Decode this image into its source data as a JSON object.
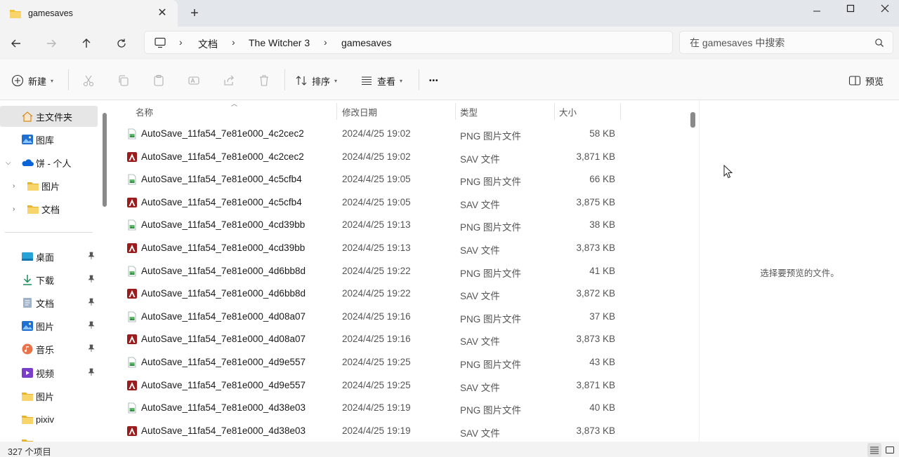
{
  "window": {
    "tab_title": "gamesaves",
    "tab_icon": "folder-icon",
    "new_tab_label": "+",
    "close_tab_label": "✕"
  },
  "address": {
    "crumbs": [
      "文档",
      "The Witcher 3",
      "gamesaves"
    ],
    "separator": "›"
  },
  "search": {
    "placeholder": "在 gamesaves 中搜索"
  },
  "toolbar": {
    "new_label": "新建",
    "sort_label": "排序",
    "view_label": "查看",
    "more_label": "•••",
    "preview_label": "预览"
  },
  "nav": {
    "items": [
      {
        "label": "主文件夹",
        "icon": "home-icon",
        "selected": true
      },
      {
        "label": "图库",
        "icon": "gallery-icon"
      },
      {
        "label": "饼 - 个人",
        "icon": "onedrive-icon",
        "expanded": true
      },
      {
        "label": "图片",
        "icon": "folder-icon"
      },
      {
        "label": "文档",
        "icon": "folder-icon"
      },
      {
        "label": "桌面",
        "icon": "desktop-icon",
        "pinned": true
      },
      {
        "label": "下载",
        "icon": "download-icon",
        "pinned": true
      },
      {
        "label": "文档",
        "icon": "document-icon",
        "pinned": true
      },
      {
        "label": "图片",
        "icon": "pictures-icon",
        "pinned": true
      },
      {
        "label": "音乐",
        "icon": "music-icon",
        "pinned": true
      },
      {
        "label": "视频",
        "icon": "video-icon",
        "pinned": true
      },
      {
        "label": "图片",
        "icon": "folder-icon"
      },
      {
        "label": "pixiv",
        "icon": "folder-icon"
      }
    ]
  },
  "columns": {
    "name": "名称",
    "date": "修改日期",
    "type": "类型",
    "size": "大小"
  },
  "files": [
    {
      "name": "AutoSave_11fa54_7e81e000_4c2cec2",
      "date": "2024/4/25 19:02",
      "type": "PNG 图片文件",
      "size": "58 KB",
      "kind": "png"
    },
    {
      "name": "AutoSave_11fa54_7e81e000_4c2cec2",
      "date": "2024/4/25 19:02",
      "type": "SAV 文件",
      "size": "3,871 KB",
      "kind": "sav"
    },
    {
      "name": "AutoSave_11fa54_7e81e000_4c5cfb4",
      "date": "2024/4/25 19:05",
      "type": "PNG 图片文件",
      "size": "66 KB",
      "kind": "png"
    },
    {
      "name": "AutoSave_11fa54_7e81e000_4c5cfb4",
      "date": "2024/4/25 19:05",
      "type": "SAV 文件",
      "size": "3,875 KB",
      "kind": "sav"
    },
    {
      "name": "AutoSave_11fa54_7e81e000_4cd39bb",
      "date": "2024/4/25 19:13",
      "type": "PNG 图片文件",
      "size": "38 KB",
      "kind": "png"
    },
    {
      "name": "AutoSave_11fa54_7e81e000_4cd39bb",
      "date": "2024/4/25 19:13",
      "type": "SAV 文件",
      "size": "3,873 KB",
      "kind": "sav"
    },
    {
      "name": "AutoSave_11fa54_7e81e000_4d6bb8d",
      "date": "2024/4/25 19:22",
      "type": "PNG 图片文件",
      "size": "41 KB",
      "kind": "png"
    },
    {
      "name": "AutoSave_11fa54_7e81e000_4d6bb8d",
      "date": "2024/4/25 19:22",
      "type": "SAV 文件",
      "size": "3,872 KB",
      "kind": "sav"
    },
    {
      "name": "AutoSave_11fa54_7e81e000_4d08a07",
      "date": "2024/4/25 19:16",
      "type": "PNG 图片文件",
      "size": "37 KB",
      "kind": "png"
    },
    {
      "name": "AutoSave_11fa54_7e81e000_4d08a07",
      "date": "2024/4/25 19:16",
      "type": "SAV 文件",
      "size": "3,873 KB",
      "kind": "sav"
    },
    {
      "name": "AutoSave_11fa54_7e81e000_4d9e557",
      "date": "2024/4/25 19:25",
      "type": "PNG 图片文件",
      "size": "43 KB",
      "kind": "png"
    },
    {
      "name": "AutoSave_11fa54_7e81e000_4d9e557",
      "date": "2024/4/25 19:25",
      "type": "SAV 文件",
      "size": "3,871 KB",
      "kind": "sav"
    },
    {
      "name": "AutoSave_11fa54_7e81e000_4d38e03",
      "date": "2024/4/25 19:19",
      "type": "PNG 图片文件",
      "size": "40 KB",
      "kind": "png"
    },
    {
      "name": "AutoSave_11fa54_7e81e000_4d38e03",
      "date": "2024/4/25 19:19",
      "type": "SAV 文件",
      "size": "3,873 KB",
      "kind": "sav"
    }
  ],
  "preview": {
    "message": "选择要预览的文件。"
  },
  "status": {
    "item_count": "327 个项目"
  },
  "colors": {
    "accent": "#0067c0",
    "folder": "#f2c335",
    "sav_icon": "#9b1c1c"
  }
}
